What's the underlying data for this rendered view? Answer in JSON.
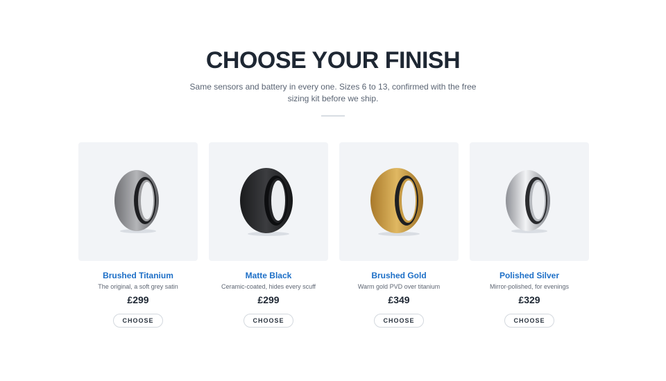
{
  "header": {
    "title": "CHOOSE YOUR FINISH",
    "subtitle": "Same sensors and battery in every one. Sizes 6 to 13, confirmed with the free sizing kit before we ship."
  },
  "products": [
    {
      "name": "Brushed Titanium",
      "description": "The original, a soft grey satin",
      "price": "£299",
      "button_label": "CHOOSE",
      "color": "#9a9a9c"
    },
    {
      "name": "Matte Black",
      "description": "Ceramic-coated, hides every scuff",
      "price": "£299",
      "button_label": "CHOOSE",
      "color": "#2b2c2e"
    },
    {
      "name": "Brushed Gold",
      "description": "Warm gold PVD over titanium",
      "price": "£349",
      "button_label": "CHOOSE",
      "color": "#d2a64a"
    },
    {
      "name": "Polished Silver",
      "description": "Mirror-polished, for evenings",
      "price": "£329",
      "button_label": "CHOOSE",
      "color": "#c9ccd1"
    }
  ]
}
